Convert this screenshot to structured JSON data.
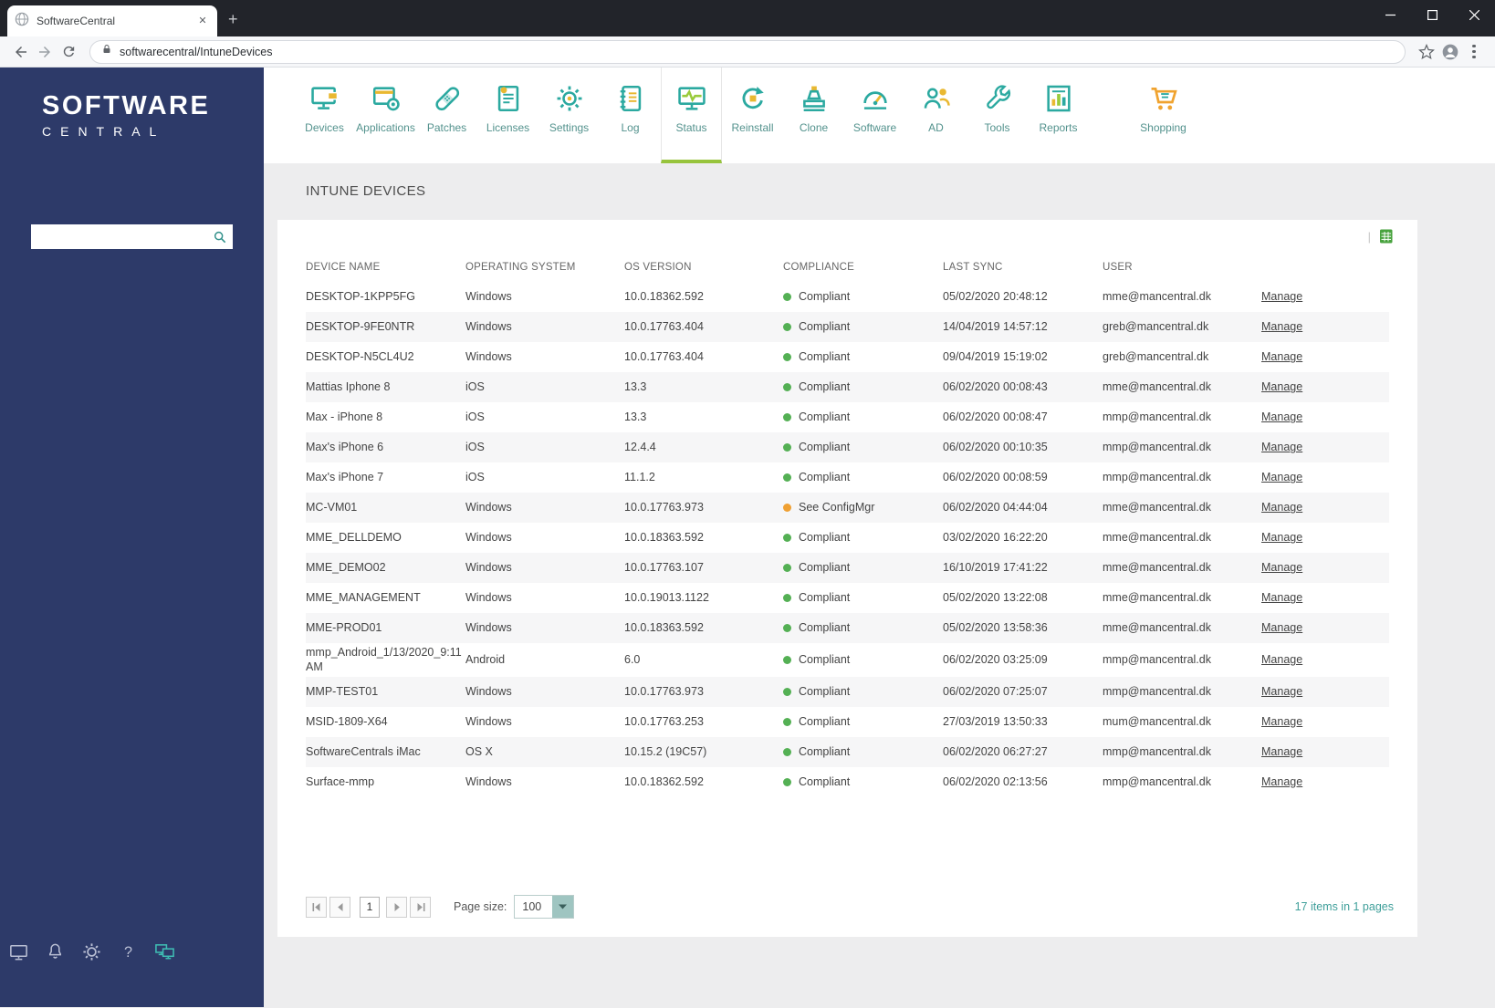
{
  "browser": {
    "tab_title": "SoftwareCentral",
    "url": "softwarecentral/IntuneDevices"
  },
  "sidebar": {
    "logo_line1": "SOFTWARE",
    "logo_line2": "CENTRAL",
    "search": {
      "value": "",
      "placeholder": ""
    },
    "footer_icons": [
      "computer",
      "notifications",
      "settings",
      "help",
      "remote-support"
    ]
  },
  "topnav": {
    "items": [
      {
        "id": "devices",
        "label": "Devices"
      },
      {
        "id": "applications",
        "label": "Applications"
      },
      {
        "id": "patches",
        "label": "Patches"
      },
      {
        "id": "licenses",
        "label": "Licenses"
      },
      {
        "id": "settings",
        "label": "Settings"
      },
      {
        "id": "log",
        "label": "Log"
      },
      {
        "id": "status",
        "label": "Status",
        "active": true
      },
      {
        "id": "reinstall",
        "label": "Reinstall"
      },
      {
        "id": "clone",
        "label": "Clone"
      },
      {
        "id": "software",
        "label": "Software"
      },
      {
        "id": "ad",
        "label": "AD"
      },
      {
        "id": "tools",
        "label": "Tools"
      },
      {
        "id": "reports",
        "label": "Reports"
      },
      {
        "id": "shopping",
        "label": "Shopping",
        "gap_before": true
      }
    ]
  },
  "page": {
    "title": "INTUNE DEVICES"
  },
  "table": {
    "columns": [
      "DEVICE NAME",
      "OPERATING SYSTEM",
      "OS VERSION",
      "COMPLIANCE",
      "LAST SYNC",
      "USER",
      ""
    ],
    "manage_label": "Manage",
    "rows": [
      {
        "device": "DESKTOP-1KPP5FG",
        "os": "Windows",
        "version": "10.0.18362.592",
        "compliance": "Compliant",
        "status": "ok",
        "last_sync": "05/02/2020 20:48:12",
        "user": "mme@mancentral.dk"
      },
      {
        "device": "DESKTOP-9FE0NTR",
        "os": "Windows",
        "version": "10.0.17763.404",
        "compliance": "Compliant",
        "status": "ok",
        "last_sync": "14/04/2019 14:57:12",
        "user": "greb@mancentral.dk"
      },
      {
        "device": "DESKTOP-N5CL4U2",
        "os": "Windows",
        "version": "10.0.17763.404",
        "compliance": "Compliant",
        "status": "ok",
        "last_sync": "09/04/2019 15:19:02",
        "user": "greb@mancentral.dk"
      },
      {
        "device": "Mattias Iphone 8",
        "os": "iOS",
        "version": "13.3",
        "compliance": "Compliant",
        "status": "ok",
        "last_sync": "06/02/2020 00:08:43",
        "user": "mme@mancentral.dk"
      },
      {
        "device": "Max - iPhone 8",
        "os": "iOS",
        "version": "13.3",
        "compliance": "Compliant",
        "status": "ok",
        "last_sync": "06/02/2020 00:08:47",
        "user": "mmp@mancentral.dk"
      },
      {
        "device": "Max's iPhone 6",
        "os": "iOS",
        "version": "12.4.4",
        "compliance": "Compliant",
        "status": "ok",
        "last_sync": "06/02/2020 00:10:35",
        "user": "mmp@mancentral.dk"
      },
      {
        "device": "Max's iPhone 7",
        "os": "iOS",
        "version": "11.1.2",
        "compliance": "Compliant",
        "status": "ok",
        "last_sync": "06/02/2020 00:08:59",
        "user": "mmp@mancentral.dk"
      },
      {
        "device": "MC-VM01",
        "os": "Windows",
        "version": "10.0.17763.973",
        "compliance": "See ConfigMgr",
        "status": "warn",
        "last_sync": "06/02/2020 04:44:04",
        "user": "mme@mancentral.dk"
      },
      {
        "device": "MME_DELLDEMO",
        "os": "Windows",
        "version": "10.0.18363.592",
        "compliance": "Compliant",
        "status": "ok",
        "last_sync": "03/02/2020 16:22:20",
        "user": "mme@mancentral.dk"
      },
      {
        "device": "MME_DEMO02",
        "os": "Windows",
        "version": "10.0.17763.107",
        "compliance": "Compliant",
        "status": "ok",
        "last_sync": "16/10/2019 17:41:22",
        "user": "mme@mancentral.dk"
      },
      {
        "device": "MME_MANAGEMENT",
        "os": "Windows",
        "version": "10.0.19013.1122",
        "compliance": "Compliant",
        "status": "ok",
        "last_sync": "05/02/2020 13:22:08",
        "user": "mme@mancentral.dk"
      },
      {
        "device": "MME-PROD01",
        "os": "Windows",
        "version": "10.0.18363.592",
        "compliance": "Compliant",
        "status": "ok",
        "last_sync": "05/02/2020 13:58:36",
        "user": "mme@mancentral.dk"
      },
      {
        "device": "mmp_Android_1/13/2020_9:11 AM",
        "os": "Android",
        "version": "6.0",
        "compliance": "Compliant",
        "status": "ok",
        "last_sync": "06/02/2020 03:25:09",
        "user": "mmp@mancentral.dk"
      },
      {
        "device": "MMP-TEST01",
        "os": "Windows",
        "version": "10.0.17763.973",
        "compliance": "Compliant",
        "status": "ok",
        "last_sync": "06/02/2020 07:25:07",
        "user": "mmp@mancentral.dk"
      },
      {
        "device": "MSID-1809-X64",
        "os": "Windows",
        "version": "10.0.17763.253",
        "compliance": "Compliant",
        "status": "ok",
        "last_sync": "27/03/2019 13:50:33",
        "user": "mum@mancentral.dk"
      },
      {
        "device": "SoftwareCentrals iMac",
        "os": "OS X",
        "version": "10.15.2 (19C57)",
        "compliance": "Compliant",
        "status": "ok",
        "last_sync": "06/02/2020 06:27:27",
        "user": "mmp@mancentral.dk"
      },
      {
        "device": "Surface-mmp",
        "os": "Windows",
        "version": "10.0.18362.592",
        "compliance": "Compliant",
        "status": "ok",
        "last_sync": "06/02/2020 02:13:56",
        "user": "mmp@mancentral.dk"
      }
    ]
  },
  "pagination": {
    "current_page": "1",
    "page_size_label": "Page size:",
    "page_size_value": "100",
    "summary": "17 items in 1 pages"
  },
  "colors": {
    "sidebar_navy": "#2d3a69",
    "accent_teal": "#2ba9a0",
    "accent_yellow": "#e9b831",
    "active_tab_green": "#97c43c",
    "compliant_green": "#54b054",
    "warning_orange": "#efa033"
  }
}
